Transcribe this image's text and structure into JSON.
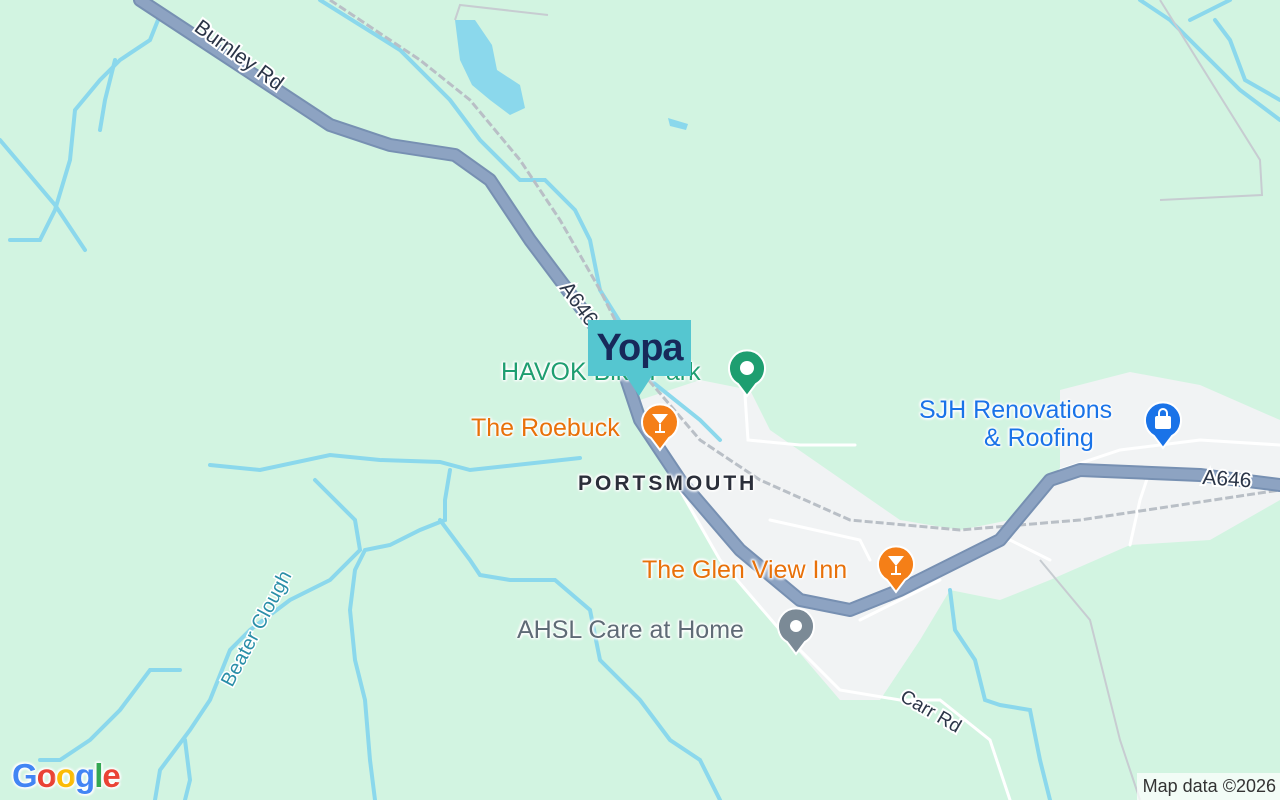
{
  "map": {
    "roads": {
      "burnley_rd": "Burnley Rd",
      "a646_north": "A646",
      "a646_east": "A646",
      "carr_rd": "Carr Rd"
    },
    "waterway": "Beater Clough",
    "town": "PORTSMOUTH",
    "pois": [
      {
        "label": "HAVOK Bike Park",
        "type": "park",
        "color": "#1e9e70",
        "icon": "park-icon"
      },
      {
        "label": "The Roebuck",
        "type": "bar",
        "color": "#f57f17",
        "icon": "cocktail-icon"
      },
      {
        "label": "SJH Renovations\n& Roofing",
        "line1": "SJH Renovations",
        "line2": "& Roofing",
        "type": "shop",
        "color": "#1a73e8",
        "icon": "shopping-bag-icon"
      },
      {
        "label": "The Glen View Inn",
        "type": "bar",
        "color": "#f57f17",
        "icon": "cocktail-icon"
      },
      {
        "label": "AHSL Care at Home",
        "type": "service",
        "color": "#7b8a96",
        "icon": "generic-poi-icon"
      }
    ],
    "brand_marker": {
      "text": "Yopa",
      "bg": "#55c6d0",
      "fg": "#17295a"
    }
  },
  "footer": {
    "logo_letters": [
      "G",
      "o",
      "o",
      "g",
      "l",
      "e"
    ],
    "logo_colors": [
      "#4285f4",
      "#ea4335",
      "#fbbc05",
      "#4285f4",
      "#34a853",
      "#ea4335"
    ],
    "attribution": "Map data ©2026"
  },
  "colors": {
    "land": "#d2f4e1",
    "water": "#8bd8ec",
    "urban": "#f1f3f4",
    "major_road": "#8da3c2",
    "minor_road": "#ffffff"
  }
}
